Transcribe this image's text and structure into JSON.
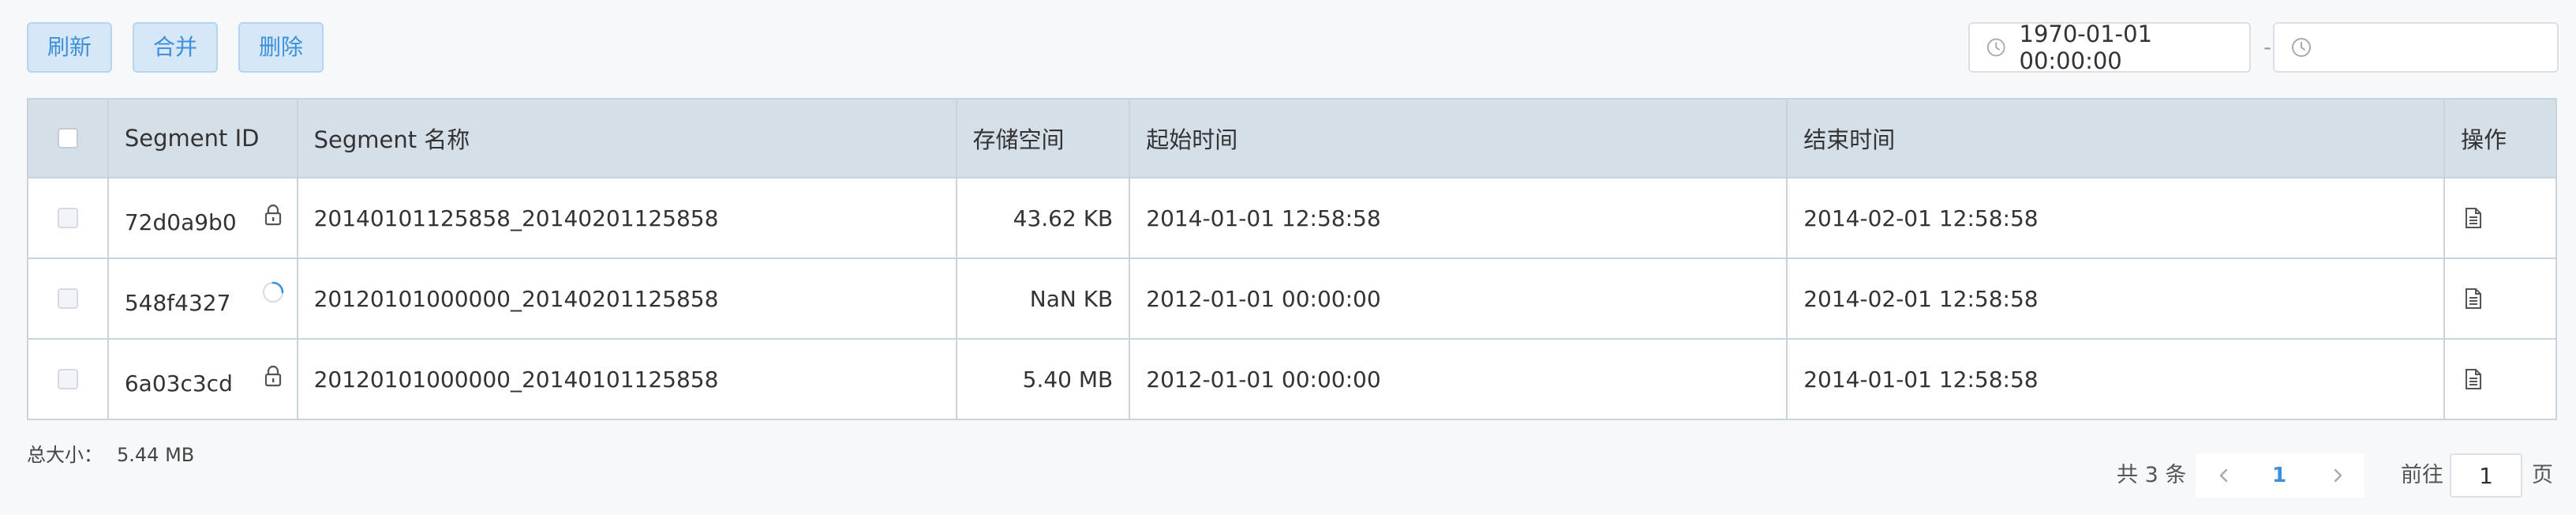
{
  "toolbar": {
    "refresh_label": "刷新",
    "merge_label": "合并",
    "delete_label": "删除"
  },
  "date_range": {
    "start_value": "1970-01-01 00:00:00",
    "separator": "-",
    "end_value": ""
  },
  "table": {
    "headers": {
      "id": "Segment ID",
      "name": "Segment 名称",
      "size": "存储空间",
      "start": "起始时间",
      "end": "结束时间",
      "op": "操作"
    },
    "rows": [
      {
        "id": "72d0a9b0",
        "status_icon": "lock-icon",
        "name": "20140101125858_20140201125858",
        "size": "43.62 KB",
        "start": "2014-01-01 12:58:58",
        "end": "2014-02-01 12:58:58",
        "op_icon": "document-icon"
      },
      {
        "id": "548f4327",
        "status_icon": "loading-spinner-icon",
        "name": "20120101000000_20140201125858",
        "size": "NaN KB",
        "start": "2012-01-01 00:00:00",
        "end": "2014-02-01 12:58:58",
        "op_icon": "document-icon"
      },
      {
        "id": "6a03c3cd",
        "status_icon": "lock-icon",
        "name": "20120101000000_20140101125858",
        "size": "5.40 MB",
        "start": "2012-01-01 00:00:00",
        "end": "2014-01-01 12:58:58",
        "op_icon": "document-icon"
      }
    ]
  },
  "footer": {
    "total_label": "总大小：",
    "total_value": "5.44 MB"
  },
  "pagination": {
    "count_text": "共 3 条",
    "current_page": "1",
    "goto_label": "前往",
    "goto_value": "1",
    "goto_suffix": "页"
  },
  "colors": {
    "accent": "#3d8fd8",
    "header_bg": "#d4dfe8",
    "border": "#c7d3dd",
    "button_bg": "#d6e8f7"
  }
}
